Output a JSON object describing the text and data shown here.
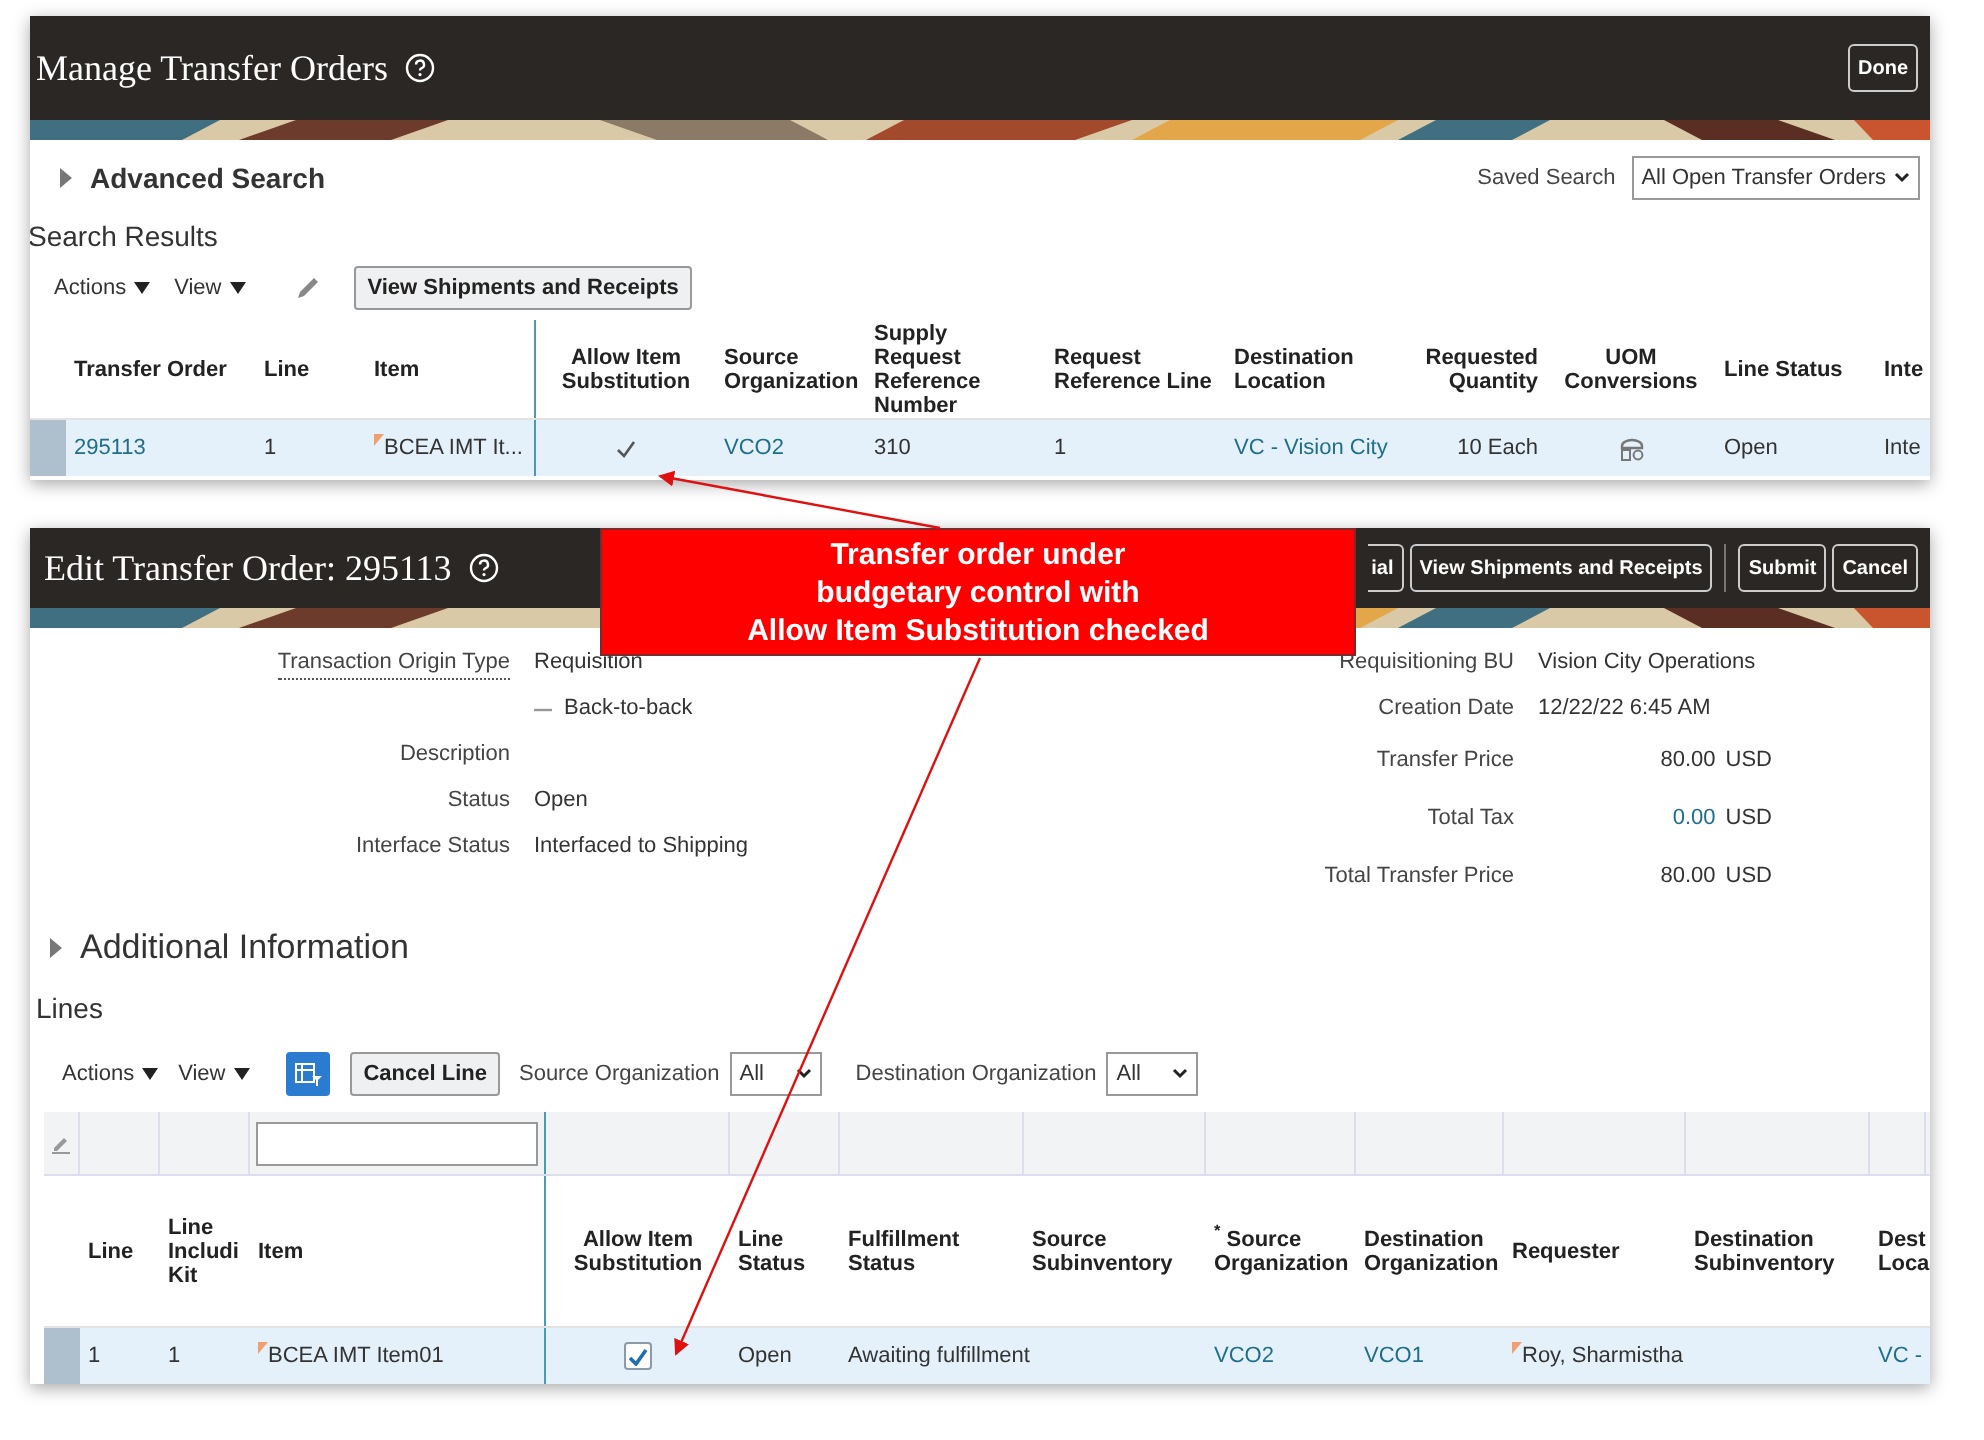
{
  "manage": {
    "title": "Manage Transfer Orders",
    "done": "Done",
    "advanced_search": {
      "label": "Advanced Search",
      "expanded": false
    },
    "saved_search": {
      "label": "Saved Search",
      "value": "All Open Transfer Orders"
    },
    "results_title": "Search Results",
    "toolbar": {
      "actions": "Actions",
      "view": "View",
      "button": "View Shipments and Receipts"
    },
    "table": {
      "columns": [
        {
          "label": "Transfer Order"
        },
        {
          "label": "Line"
        },
        {
          "label": "Item"
        },
        {
          "label": "Allow Item Substitution"
        },
        {
          "label": "Source Organization"
        },
        {
          "label": "Supply Request Reference Number"
        },
        {
          "label": "Request Reference Line"
        },
        {
          "label": "Destination Location"
        },
        {
          "label": "Requested Quantity"
        },
        {
          "label": "UOM Conversions"
        },
        {
          "label": "Line Status"
        },
        {
          "label": "Inte"
        }
      ],
      "rows": [
        {
          "selected": true,
          "cells": [
            {
              "kind": "link",
              "text": "295113"
            },
            {
              "kind": "text",
              "text": "1"
            },
            {
              "kind": "item",
              "text": "BCEA IMT It..."
            },
            {
              "kind": "check",
              "checked": true
            },
            {
              "kind": "link",
              "text": "VCO2"
            },
            {
              "kind": "text",
              "text": "310"
            },
            {
              "kind": "text",
              "text": "1"
            },
            {
              "kind": "link",
              "text": "VC - Vision City"
            },
            {
              "kind": "number",
              "text": "10 Each"
            },
            {
              "kind": "uom"
            },
            {
              "kind": "text",
              "text": "Open"
            },
            {
              "kind": "text",
              "text": "Inte"
            }
          ]
        }
      ]
    }
  },
  "edit": {
    "title": "Edit Transfer Order: 295113",
    "actions": [
      "ial",
      "View Shipments and Receipts"
    ],
    "commands": [
      "Submit",
      "Cancel"
    ],
    "left_fields": [
      {
        "kind": "field",
        "label": "Transaction Origin Type",
        "value": "Requisition",
        "has_help": true
      },
      {
        "kind": "flag",
        "label": "Back-to-back",
        "checked": false
      },
      {
        "kind": "field",
        "label": "Description",
        "has_help": false
      },
      {
        "kind": "field",
        "label": "Status",
        "value": "Open",
        "has_help": false
      },
      {
        "kind": "field",
        "label": "Interface Status",
        "value": "Interfaced to Shipping",
        "has_help": false
      }
    ],
    "right_fields": [
      {
        "kind": "field",
        "label": "Requisitioning BU",
        "value": "Vision City Operations"
      },
      {
        "kind": "field",
        "label": "Creation Date",
        "value": "12/22/22 6:45 AM"
      },
      {
        "kind": "amount",
        "label": "Transfer Price",
        "value": "80.00",
        "currency": "USD",
        "link": false
      },
      {
        "kind": "amount",
        "label": "Total Tax",
        "value": "0.00",
        "currency": "USD",
        "link": true
      },
      {
        "kind": "amount",
        "label": "Total Transfer Price",
        "value": "80.00",
        "currency": "USD",
        "link": false
      }
    ],
    "additional_info": {
      "label": "Additional Information",
      "expanded": false
    },
    "lines_title": "Lines",
    "lines_toolbar": {
      "actions": "Actions",
      "view": "View",
      "cancel_button": "Cancel Line",
      "filters": [
        {
          "label": "Source Organization",
          "value": "All"
        },
        {
          "label": "Destination Organization",
          "value": "All"
        }
      ]
    },
    "table": {
      "columns": [
        {
          "label": "Line",
          "filter": false
        },
        {
          "label": "Line Includi Kit",
          "filter": false
        },
        {
          "label": "Item",
          "filter": true
        },
        {
          "label": "Allow Item Substitution",
          "filter": false
        },
        {
          "label": "Line Status",
          "filter": false
        },
        {
          "label": "Fulfillment Status",
          "filter": false
        },
        {
          "label": "Source Subinventory",
          "filter": false
        },
        {
          "label": "$^{*}$ Source Organization",
          "filter": false
        },
        {
          "label": "Destination Organization",
          "filter": false
        },
        {
          "label": "Requester",
          "filter": false
        },
        {
          "label": "Destination Subinventory",
          "filter": false
        },
        {
          "label": "Dest Loca",
          "filter": false
        }
      ],
      "rows": [
        {
          "selected": true,
          "cells": [
            {
              "kind": "text",
              "text": "1"
            },
            {
              "kind": "text",
              "text": "1"
            },
            {
              "kind": "item",
              "text": "BCEA IMT Item01"
            },
            {
              "kind": "checkbox",
              "checked": true
            },
            {
              "kind": "text",
              "text": "Open"
            },
            {
              "kind": "text",
              "text": "Awaiting fulfillment"
            },
            {
              "kind": "empty"
            },
            {
              "kind": "link",
              "text": "VCO2"
            },
            {
              "kind": "link",
              "text": "VCO1"
            },
            {
              "kind": "item",
              "text": "Roy, Sharmistha"
            },
            {
              "kind": "empty"
            },
            {
              "kind": "link",
              "text": "VC -"
            }
          ]
        }
      ]
    }
  },
  "callout": {
    "text": "Transfer order under\nbudgetary control with\nAllow Item Substitution checked"
  }
}
